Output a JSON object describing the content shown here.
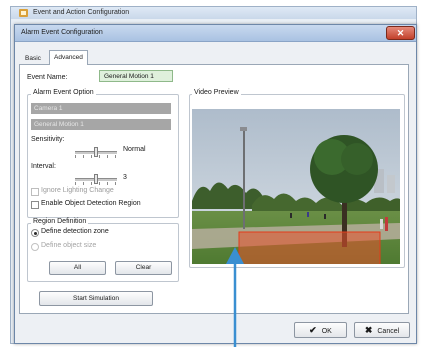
{
  "parent_window": {
    "title": "Event and Action Configuration"
  },
  "dialog": {
    "title": "Alarm Event Configuration",
    "close_label": "✕"
  },
  "tabs": [
    {
      "label": "Basic",
      "active": false
    },
    {
      "label": "Advanced",
      "active": true
    }
  ],
  "event_name": {
    "label": "Event Name:",
    "value": "General Motion 1"
  },
  "alarm_event_option": {
    "title": "Alarm Event Option",
    "camera": "Camera 1",
    "motion": "General Motion 1",
    "sensitivity_label": "Sensitivity:",
    "sensitivity_value": "Normal",
    "interval_label": "Interval:",
    "interval_value": "3",
    "ignore_lighting_label": "Ignore Lighting Change",
    "ignore_lighting_checked": false,
    "enable_object_detection_label": "Enable Object Detection Region",
    "enable_object_detection_checked": false
  },
  "region_definition": {
    "title": "Region Definition",
    "define_zone_label": "Define detection zone",
    "define_size_label": "Define object size",
    "selected": "Define detection zone",
    "all_label": "All",
    "clear_label": "Clear"
  },
  "video_preview": {
    "title": "Video Preview"
  },
  "buttons": {
    "start_simulation": "Start Simulation",
    "ok": "OK",
    "cancel": "Cancel"
  },
  "colors": {
    "titlebar": "#b8cde8",
    "event_name_bg": "#dff0dc",
    "disabled_field": "#a6a6a6",
    "detection_zone": "#e8502c",
    "annotation_arrow": "#3a8fd1"
  }
}
